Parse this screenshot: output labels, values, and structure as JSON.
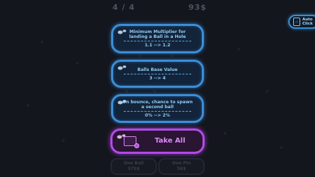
{
  "hud": {
    "progress": "4 / 4",
    "money": "93$"
  },
  "auto_click": {
    "line1": "Auto",
    "line2": "Click"
  },
  "upgrades": [
    {
      "title": "Minimum Multiplier for landing a Ball in a Hole",
      "values": "1.1 --> 1.2"
    },
    {
      "title": "Balls Base Value",
      "values": "3 --> 4"
    },
    {
      "title": "On bounce, chance to spawn a second ball",
      "values": "0% --> 2%"
    }
  ],
  "take_all": {
    "label": "Take All"
  },
  "bottom": {
    "one_ball_label": "One Ball",
    "one_ball_price": "375$",
    "one_pin_label": "One Pin",
    "one_pin_price": "56$"
  },
  "colors": {
    "background": "#14161d",
    "upgrade_border": "#3d8ed6",
    "upgrade_text": "#8fcaf2",
    "take_all_border": "#b34be6",
    "take_all_text": "#d98af5"
  }
}
